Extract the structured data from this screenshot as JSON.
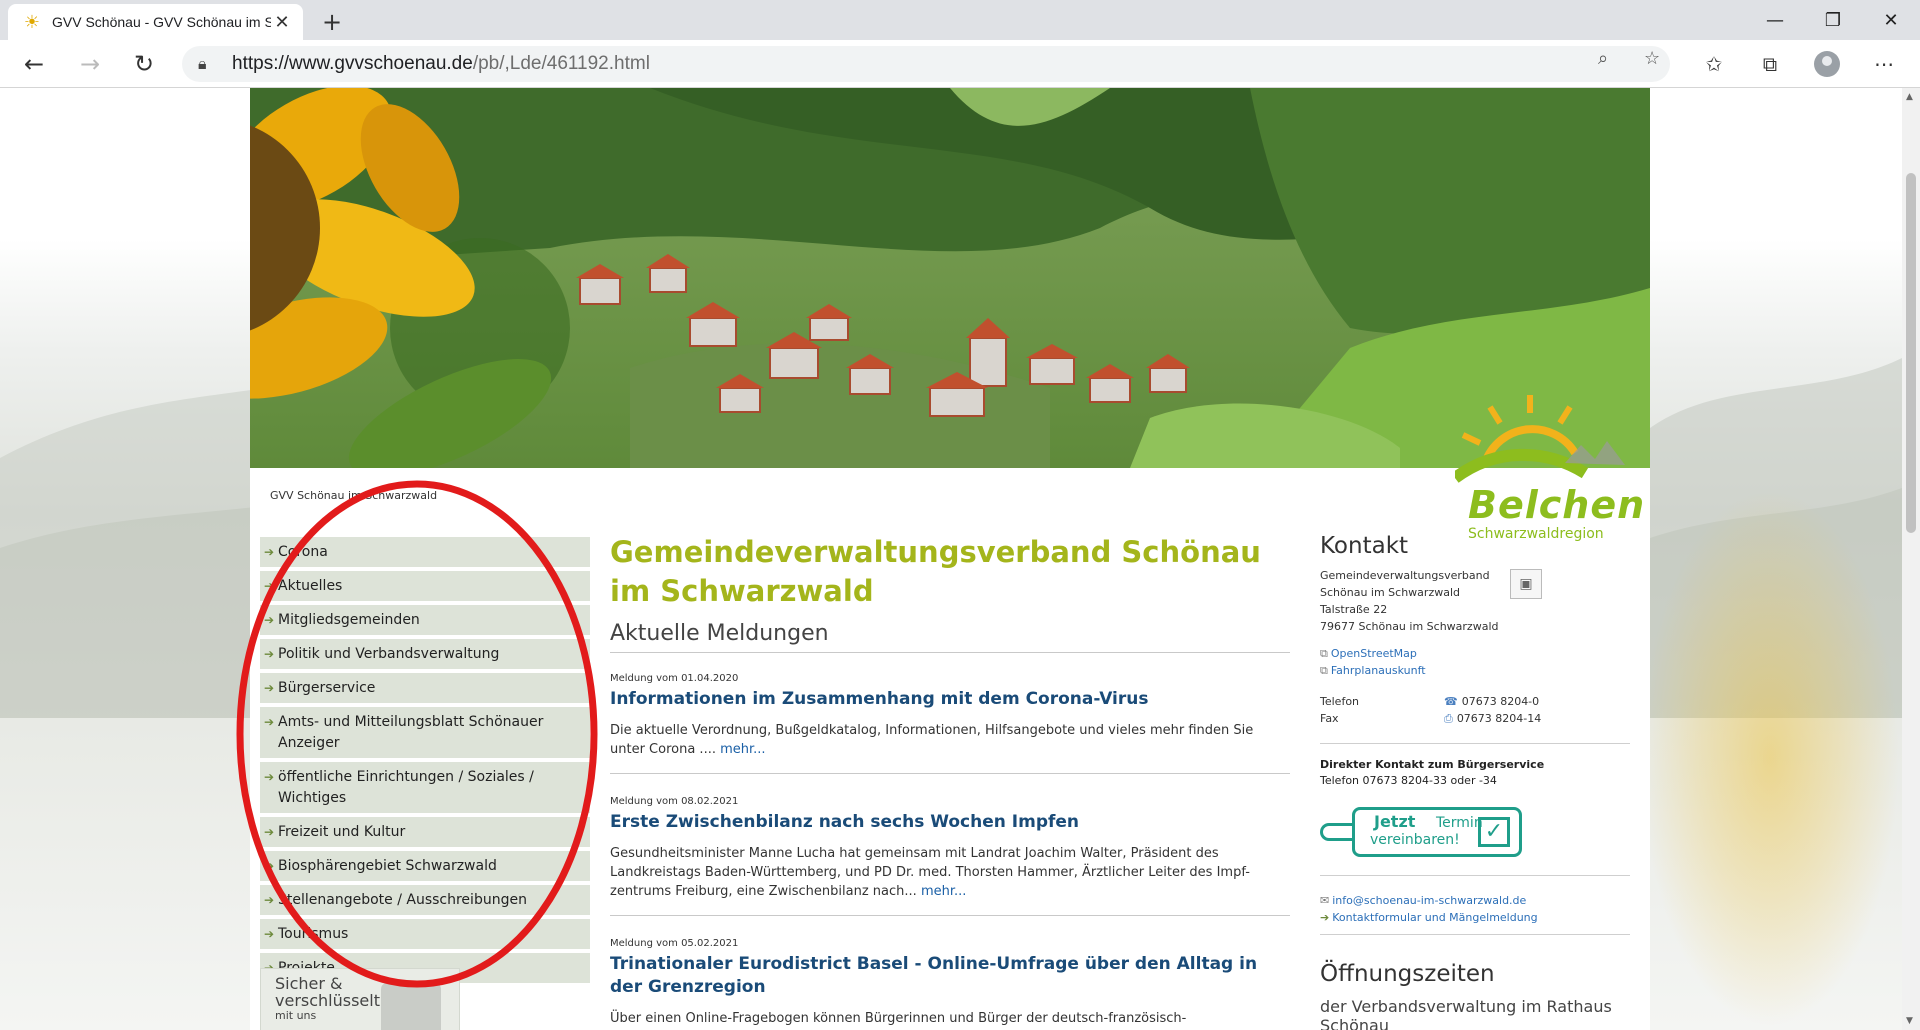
{
  "browser": {
    "tab_title": "GVV Schönau - GVV Schönau im Schwarzwald",
    "url_host": "https://www.gvvschoenau.de",
    "url_path": "/pb/,Lde/461192.html"
  },
  "breadcrumb": "GVV Schönau im Schwarzwald",
  "logo": {
    "word": "Belchen",
    "sub": "Schwarzwaldregion"
  },
  "nav": [
    "Corona",
    "Aktuelles",
    "Mitgliedsgemeinden",
    "Politik und Verbandsverwaltung",
    "Bürgerservice",
    "Amts- und Mitteilungsblatt Schönauer Anzeiger",
    "öffentliche Einrichtungen / Soziales / Wichtiges",
    "Freizeit und Kultur",
    "Biosphärengebiet Schwarzwald",
    "Stellenangebote / Ausschreibungen",
    "Tourismus",
    "Projekte"
  ],
  "badge": {
    "line1": "Sicher &",
    "line2": "verschlüsselt",
    "small": "mit uns"
  },
  "main": {
    "title": "Gemeindeverwaltungsverband Schönau im Schwarzwald",
    "section": "Aktuelle Meldungen",
    "news": [
      {
        "meta": "Meldung vom 01.04.2020",
        "title": "Informationen im Zusammenhang mit dem Corona-Virus",
        "body": "Die aktuelle Verordnung, Bußgeldkatalog, Informationen, Hilfsangebote und vieles mehr finden Sie unter Corona ....",
        "more": "mehr..."
      },
      {
        "meta": "Meldung vom 08.02.2021",
        "title": "Erste Zwischenbilanz nach sechs Wochen Impfen",
        "body": "Gesundheitsminister Manne Lucha hat gemeinsam mit Landrat Joachim Walter, Präsident des Landkreistags Baden-Württemberg, und PD Dr. med. Thorsten Hammer, Ärztlicher Leiter des Impf-zentrums Freiburg, eine Zwischenbilanz nach...",
        "more": "mehr..."
      },
      {
        "meta": "Meldung vom 05.02.2021",
        "title": "Trinationaler Eurodistrict Basel - Online-Umfrage über den Alltag in der Grenzregion",
        "body": "Über einen Online-Fragebogen können Bürgerinnen und Bürger der deutsch-französisch-",
        "more": ""
      }
    ]
  },
  "contact": {
    "heading": "Kontakt",
    "org1": "Gemeindeverwaltungsverband",
    "org2": "Schönau im Schwarzwald",
    "street": "Talstraße 22",
    "city": "79677  Schönau im Schwarzwald",
    "link_map": "OpenStreetMap",
    "link_fahrplan": "Fahrplanauskunft",
    "tel_label": "Telefon",
    "tel_value": "07673 8204-0",
    "fax_label": "Fax",
    "fax_value": "07673 8204-14",
    "direct_title": "Direkter Kontakt zum Bürgerservice",
    "direct_tel": "Telefon 07673 8204-33 oder -34",
    "termin_word1": "Jetzt",
    "termin_word2": "Termin",
    "termin_word3": "vereinbaren!",
    "email": "info@schoenau-im-schwarzwald.de",
    "form_link": "Kontaktformular und Mängelmeldung",
    "hours_heading": "Öffnungszeiten",
    "hours_sub": "der Verbandsverwaltung im Rathaus Schönau"
  }
}
